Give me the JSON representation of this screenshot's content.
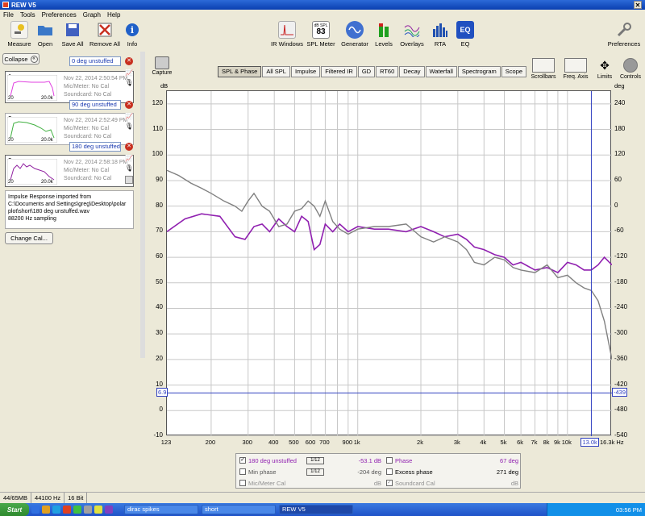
{
  "window": {
    "title": "REW V5"
  },
  "menu": [
    "File",
    "Tools",
    "Preferences",
    "Graph",
    "Help"
  ],
  "toolbar_left": [
    {
      "label": "Measure",
      "icon": "microphone-icon",
      "color": "#e8c020"
    },
    {
      "label": "Open",
      "icon": "folder-icon",
      "color": "#3a78c8"
    },
    {
      "label": "Save All",
      "icon": "save-icon",
      "color": "#4060c0"
    },
    {
      "label": "Remove All",
      "icon": "remove-all-icon",
      "color": "#c83020"
    },
    {
      "label": "Info",
      "icon": "info-icon",
      "color": "#2060c8"
    }
  ],
  "toolbar_center": [
    {
      "label": "IR Windows",
      "icon": "ir-windows-icon"
    },
    {
      "label": "SPL Meter",
      "icon": "spl-meter-icon",
      "meter_label": "dB SPL",
      "meter_value": "83"
    },
    {
      "label": "Generator",
      "icon": "generator-icon"
    },
    {
      "label": "Levels",
      "icon": "levels-icon"
    },
    {
      "label": "Overlays",
      "icon": "overlays-icon"
    },
    {
      "label": "RTA",
      "icon": "rta-icon"
    },
    {
      "label": "EQ",
      "icon": "eq-icon",
      "badge": "EQ"
    }
  ],
  "toolbar_right": {
    "label": "Preferences",
    "icon": "wrench-icon"
  },
  "sidebar": {
    "collapse_label": "Collapse",
    "measurements": [
      {
        "num": "1",
        "name": "0 deg unstuffed",
        "date": "Nov 22, 2014 2:50:54 PM",
        "mic": "Mic/Meter: No Cal",
        "sound": "Soundcard: No Cal",
        "color": "#e040e0",
        "axis_lo": "20",
        "axis_hi": "20.0k"
      },
      {
        "num": "2",
        "name": "90 deg unstuffed",
        "date": "Nov 22, 2014 2:52:49 PM",
        "mic": "Mic/Meter: No Cal",
        "sound": "Soundcard: No Cal",
        "color": "#40b040",
        "axis_lo": "20",
        "axis_hi": "20.0k"
      },
      {
        "num": "3",
        "name": "180 deg unstuffed",
        "date": "Nov 22, 2014 2:58:18 PM",
        "mic": "Mic/Meter: No Cal",
        "sound": "Soundcard: No Cal",
        "color": "#9020a0",
        "axis_lo": "20",
        "axis_hi": "20.0k"
      }
    ],
    "info_lines": [
      "Impulse Response imported from",
      "C:\\Documents and Settings\\greg\\Desktop\\polar",
      "plot\\short\\180 deg unstuffed.wav",
      "88200 Hz sampling"
    ],
    "change_cal_label": "Change Cal..."
  },
  "capture_label": "Capture",
  "tabs": [
    "SPL & Phase",
    "All SPL",
    "Impulse",
    "Filtered IR",
    "GD",
    "RT60",
    "Decay",
    "Waterfall",
    "Spectrogram",
    "Scope"
  ],
  "active_tab": "SPL & Phase",
  "graph_tools": [
    {
      "label": "Scrollbars",
      "icon": "scrollbars-icon"
    },
    {
      "label": "Freq. Axis",
      "icon": "freq-axis-icon"
    },
    {
      "label": "Limits",
      "icon": "limits-icon"
    },
    {
      "label": "Controls",
      "icon": "controls-icon"
    }
  ],
  "chart_data": {
    "type": "line",
    "ylabel": "dB",
    "ylabel_right": "deg",
    "xscale": "log",
    "xlim": [
      123,
      16300
    ],
    "ylim": [
      -10,
      125
    ],
    "ylim_right": [
      -540,
      270
    ],
    "yticks": [
      120,
      110,
      100,
      90,
      80,
      70,
      60,
      50,
      40,
      30,
      20,
      10,
      0,
      -10
    ],
    "yticks_right": [
      240,
      180,
      120,
      60,
      0,
      -60,
      -120,
      -180,
      -240,
      -300,
      -360,
      -420,
      -480,
      -540
    ],
    "xticks": [
      {
        "v": 123,
        "label": "123"
      },
      {
        "v": 200,
        "label": "200"
      },
      {
        "v": 300,
        "label": "300"
      },
      {
        "v": 400,
        "label": "400"
      },
      {
        "v": 500,
        "label": "500"
      },
      {
        "v": 600,
        "label": "600"
      },
      {
        "v": 700,
        "label": "700"
      },
      {
        "v": 900,
        "label": "900"
      },
      {
        "v": 1000,
        "label": "1k"
      },
      {
        "v": 2000,
        "label": "2k"
      },
      {
        "v": 3000,
        "label": "3k"
      },
      {
        "v": 4000,
        "label": "4k"
      },
      {
        "v": 5000,
        "label": "5k"
      },
      {
        "v": 6000,
        "label": "6k"
      },
      {
        "v": 7000,
        "label": "7k"
      },
      {
        "v": 8000,
        "label": "8k"
      },
      {
        "v": 9000,
        "label": "9k"
      },
      {
        "v": 10000,
        "label": "10k"
      },
      {
        "v": 16300,
        "label": "16.3k Hz"
      }
    ],
    "grid": true,
    "cursor": {
      "x": 13000,
      "x_label": "13.0k",
      "y": 6.9,
      "y_label": "6.9",
      "y_right_label": "-439"
    },
    "series": [
      {
        "name": "180 deg unstuffed",
        "color": "#9020b0",
        "x": [
          123,
          150,
          180,
          220,
          260,
          290,
          320,
          350,
          380,
          420,
          460,
          500,
          540,
          580,
          620,
          660,
          700,
          760,
          820,
          900,
          1000,
          1200,
          1400,
          1700,
          2000,
          2300,
          2600,
          3000,
          3300,
          3600,
          4000,
          4500,
          5000,
          5500,
          6000,
          7000,
          8000,
          9000,
          10000,
          11000,
          12000,
          13000,
          14000,
          15000,
          16300
        ],
        "y": [
          70,
          75,
          77,
          76,
          68,
          67,
          72,
          73,
          70,
          75,
          72,
          70,
          76,
          74,
          63,
          65,
          73,
          70,
          73,
          70,
          72,
          71,
          71,
          70,
          72,
          70,
          68,
          69,
          67,
          64,
          63,
          61,
          60,
          57,
          58,
          55,
          56,
          54,
          58,
          57,
          55,
          55,
          57,
          60,
          57
        ]
      },
      {
        "name": "Min phase",
        "color": "#808080",
        "x": [
          123,
          140,
          160,
          180,
          200,
          230,
          260,
          280,
          300,
          320,
          350,
          380,
          420,
          460,
          500,
          540,
          580,
          620,
          660,
          700,
          760,
          820,
          900,
          1000,
          1200,
          1400,
          1700,
          2000,
          2300,
          2600,
          3000,
          3300,
          3600,
          4000,
          4500,
          5000,
          5500,
          6000,
          7000,
          8000,
          9000,
          10000,
          11000,
          12000,
          13000,
          14000,
          15000,
          16300
        ],
        "y": [
          94,
          92,
          89,
          87,
          85,
          82,
          80,
          78,
          82,
          85,
          80,
          78,
          72,
          73,
          78,
          79,
          82,
          80,
          76,
          82,
          74,
          71,
          69,
          71,
          72,
          72,
          73,
          68,
          66,
          68,
          66,
          63,
          58,
          57,
          60,
          59,
          56,
          55,
          54,
          57,
          52,
          53,
          50,
          48,
          47,
          43,
          35,
          20
        ]
      }
    ]
  },
  "legend": {
    "rows": [
      {
        "checked": true,
        "name": "180 deg unstuffed",
        "value": "-53.1 dB",
        "color": "#9020b0",
        "smooth": "1/12"
      },
      {
        "checked": false,
        "name": "Phase",
        "value": "67 deg",
        "color": "#9020b0"
      },
      {
        "checked": false,
        "name": "Min phase",
        "value": "-204 deg",
        "color": "#808080",
        "smooth": "1/12"
      },
      {
        "checked": false,
        "name": "Excess phase",
        "value": "271 deg",
        "color": "#000000"
      },
      {
        "checked": false,
        "name": "Mic/Meter Cal",
        "value": "dB",
        "color": "#909090"
      },
      {
        "checked": true,
        "name": "Soundcard Cal",
        "value": "dB",
        "color": "#909090"
      }
    ]
  },
  "status": [
    "44/65MB",
    "44100 Hz",
    "16 Bit"
  ],
  "taskbar": {
    "start_label": "Start",
    "tasks": [
      "dirac spikes",
      "short",
      "REW V5"
    ],
    "active_task": "REW V5",
    "clock": "03:56 PM"
  }
}
